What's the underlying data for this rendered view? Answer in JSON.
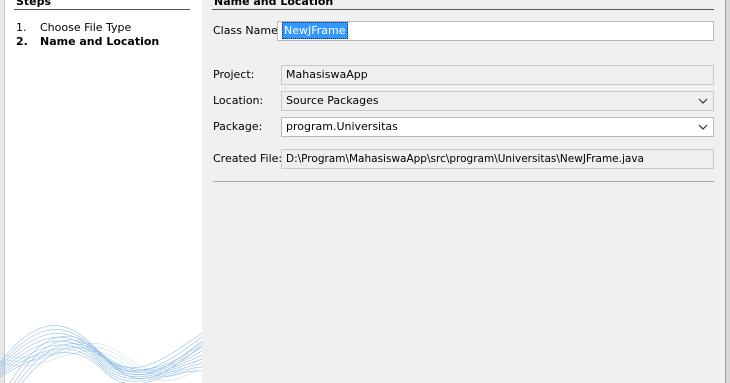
{
  "steps": {
    "title": "Steps",
    "items": [
      {
        "num": "1.",
        "label": "Choose File Type"
      },
      {
        "num": "2.",
        "label": "Name and Location"
      }
    ]
  },
  "section": {
    "title": "Name and Location"
  },
  "form": {
    "class_name_label": "Class Name:",
    "class_name_value": "NewJFrame",
    "project_label": "Project:",
    "project_value": "MahasiswaApp",
    "location_label": "Location:",
    "location_value": "Source Packages",
    "package_label": "Package:",
    "package_value": "program.Universitas",
    "created_file_label": "Created File:",
    "created_file_value": "D:\\Program\\MahasiswaApp\\src\\program\\Universitas\\NewJFrame.java"
  },
  "icons": {
    "location_dropdown": "chevron-down-icon",
    "package_dropdown": "chevron-down-icon"
  },
  "colors": {
    "selection": "#3399ff",
    "panel_bg": "#f0f0f0",
    "steps_bg": "#ffffff",
    "wave": "#6fa8dc"
  }
}
